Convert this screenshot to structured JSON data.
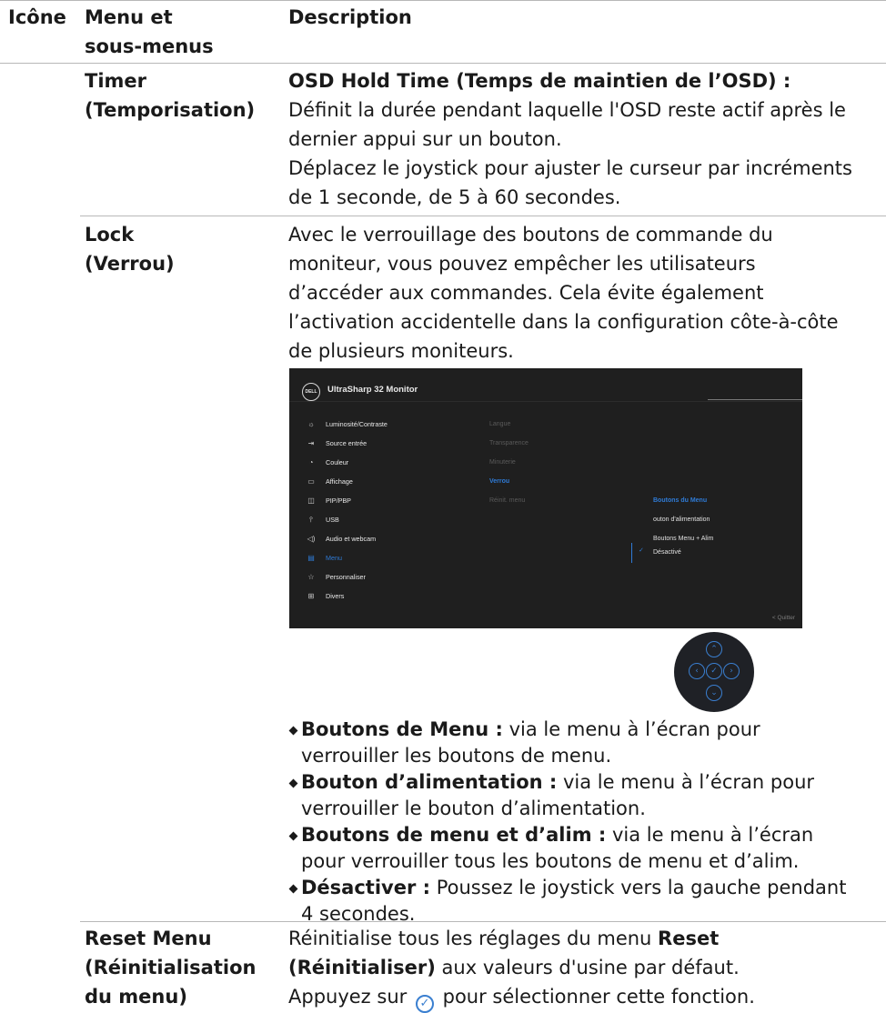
{
  "header": {
    "col_icon": "Icône",
    "col_menu_line1": "Menu et",
    "col_menu_line2": "sous-menus",
    "col_desc": "Description"
  },
  "rows": {
    "timer": {
      "menu_line1": "Timer",
      "menu_line2": "(Temporisation)",
      "heading": "OSD Hold Time (Temps de maintien de l’OSD) :",
      "line1": "Définit la durée pendant laquelle l'OSD reste actif après le",
      "line2": "dernier appui sur un bouton.",
      "line3": "Déplacez le joystick pour ajuster le curseur par incréments",
      "line4": "de 1 seconde, de 5 à 60 secondes."
    },
    "lock": {
      "menu_line1": "Lock",
      "menu_line2": "(Verrou)",
      "line1": "Avec le verrouillage des boutons de commande du",
      "line2": "moniteur, vous pouvez empêcher les utilisateurs",
      "line3": "d’accéder aux commandes. Cela évite également",
      "line4": "l’activation accidentelle dans la configuration côte-à-côte",
      "line5": "de plusieurs moniteurs."
    },
    "reset": {
      "menu_line1": "Reset Menu",
      "menu_line2": "(Réinitialisation",
      "menu_line3": "du menu)",
      "line1_pre": "Réinitialise tous les réglages du menu ",
      "line1_bold": "Reset",
      "line2_bold": "(Réinitialiser)",
      "line2_post": " aux valeurs d'usine par défaut.",
      "line3_pre": "Appuyez sur ",
      "line3_post": " pour sélectionner cette fonction."
    }
  },
  "osd": {
    "logo": "DELL",
    "title": "UltraSharp 32 Monitor",
    "menu": [
      {
        "icon": "☼",
        "label": "Luminosité/Contraste"
      },
      {
        "icon": "⇥",
        "label": "Source entrée"
      },
      {
        "icon": "◔",
        "label": "Couleur"
      },
      {
        "icon": "▭",
        "label": "Affichage"
      },
      {
        "icon": "◫",
        "label": "PIP/PBP"
      },
      {
        "icon": "⫯",
        "label": "USB"
      },
      {
        "icon": "◁)",
        "label": "Audio et webcam"
      },
      {
        "icon": "▤",
        "label": "Menu"
      },
      {
        "icon": "☆",
        "label": "Personnaliser"
      },
      {
        "icon": "⊞",
        "label": "Divers"
      }
    ],
    "submenu": [
      "Langue",
      "Transparence",
      "Minuterie",
      "Verrou",
      "Réinit. menu"
    ],
    "options": [
      "Boutons du Menu",
      "outon d'alimentation",
      "Boutons Menu + Alim",
      "Désactivé"
    ],
    "quit": "< Quitter"
  },
  "bullets": [
    {
      "bold": "Boutons de Menu :",
      "text": " via le menu à l’écran pour",
      "text2": "verrouiller les boutons de menu."
    },
    {
      "bold": "Bouton d’alimentation :",
      "text": " via le menu à l’écran pour",
      "text2": "verrouiller le bouton d’alimentation."
    },
    {
      "bold": "Boutons de menu et d’alim :",
      "text": " via le menu à l’écran",
      "text2": "pour verrouiller tous les boutons de menu et d’alim."
    },
    {
      "bold": "Désactiver :",
      "text": " Poussez le joystick vers la gauche pendant",
      "text2": "4 secondes."
    }
  ],
  "colors": {
    "accent": "#2f7bd6",
    "osd_bg": "#1f1f1f",
    "rule": "#b8b8b8"
  },
  "icons": {
    "select": "check-circle-icon",
    "joystick": "joystick-icon"
  }
}
